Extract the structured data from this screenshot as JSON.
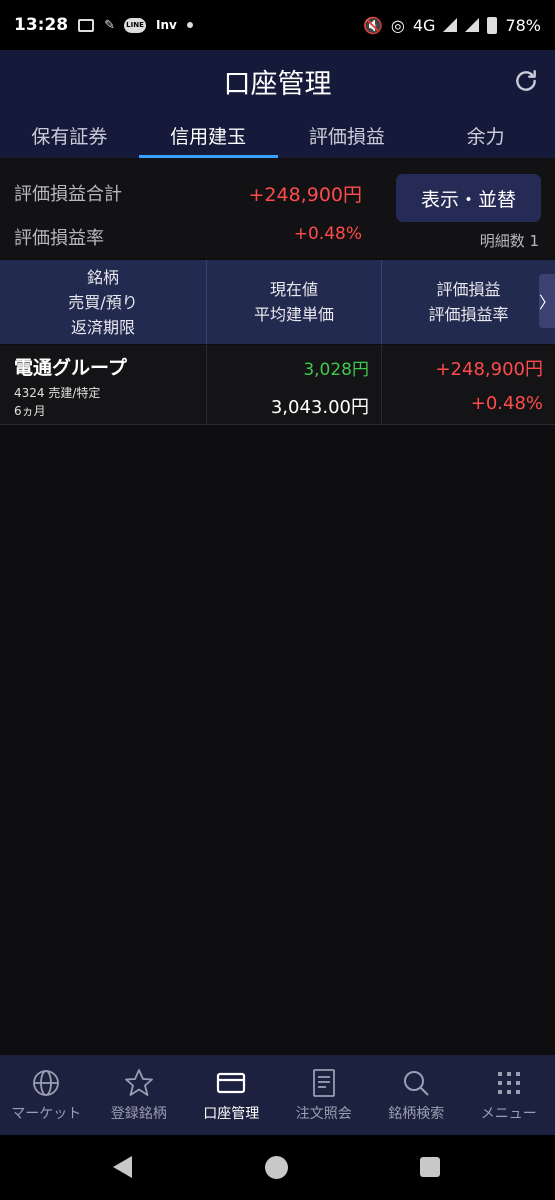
{
  "status_bar": {
    "time": "13:28",
    "network": "4G",
    "battery": "78%",
    "icons": [
      "message-icon",
      "line-icon",
      "inv-icon",
      "dot-icon",
      "mute-icon",
      "hotspot-icon",
      "signal-icon",
      "battery-icon"
    ],
    "line_label": "LINE",
    "inv_label": "Inv"
  },
  "header": {
    "title": "口座管理",
    "refresh_icon": "refresh-icon"
  },
  "tabs": [
    {
      "label": "保有証券",
      "active": false
    },
    {
      "label": "信用建玉",
      "active": true
    },
    {
      "label": "評価損益",
      "active": false
    },
    {
      "label": "余力",
      "active": false
    }
  ],
  "summary": {
    "total_label": "評価損益合計",
    "total_value": "+248,900円",
    "rate_label": "評価損益率",
    "rate_value": "+0.48%",
    "sort_button": "表示・並替",
    "count_label": "明細数 1"
  },
  "table": {
    "headers": {
      "col1": [
        "銘柄",
        "売買/預り",
        "返済期限"
      ],
      "col2": [
        "現在値",
        "平均建単価"
      ],
      "col3": [
        "評価損益",
        "評価損益率"
      ],
      "more_arrow": "〉"
    },
    "rows": [
      {
        "name": "電通グループ",
        "sub1": "4324 売建/特定",
        "sub2": "6ヵ月",
        "current_price": "3,028円",
        "avg_price": "3,043.00円",
        "pl": "+248,900円",
        "pl_rate": "+0.48%"
      }
    ]
  },
  "bottom_nav": [
    {
      "label": "マーケット",
      "icon": "globe-icon",
      "active": false
    },
    {
      "label": "登録銘柄",
      "icon": "star-icon",
      "active": false
    },
    {
      "label": "口座管理",
      "icon": "card-icon",
      "active": true
    },
    {
      "label": "注文照会",
      "icon": "document-icon",
      "active": false
    },
    {
      "label": "銘柄検索",
      "icon": "search-icon",
      "active": false
    },
    {
      "label": "メニュー",
      "icon": "grid-menu-icon",
      "active": false
    }
  ],
  "colors": {
    "header_bg": "#151a3a",
    "accent_blue": "#3aa0ff",
    "positive_red": "#ff4b4b",
    "price_green": "#3fc84a",
    "button_bg": "#262b55"
  }
}
